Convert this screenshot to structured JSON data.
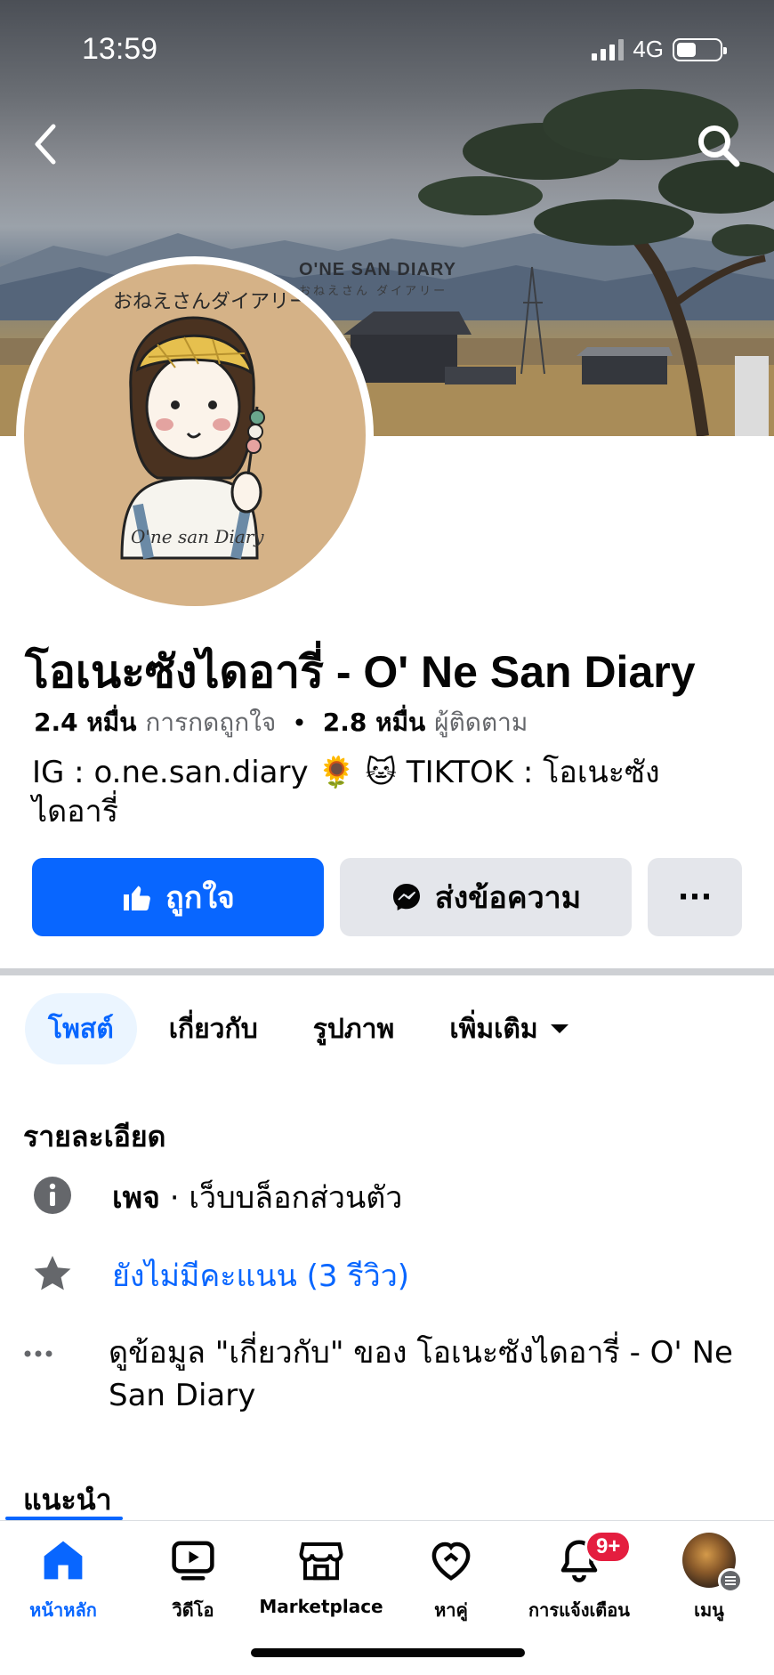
{
  "status_bar": {
    "time": "13:59",
    "network": "4G"
  },
  "cover": {
    "title": "O'NE SAN DIARY",
    "subtitle": "おねえさん ダイアリー"
  },
  "avatar": {
    "jp_text": "おねえさんダイアリー",
    "caption": "O'ne san Diary"
  },
  "profile": {
    "name": "โอเนะซังไดอารี่ - O' Ne San Diary",
    "likes_count": "2.4 หมื่น",
    "likes_label": "การกดถูกใจ",
    "followers_count": "2.8 หมื่น",
    "followers_label": "ผู้ติดตาม",
    "bio_line1": "IG : o.ne.san.diary 🌻 🐱 TIKTOK : โอเนะซัง",
    "bio_line2": "ไดอารี่"
  },
  "actions": {
    "like_label": "ถูกใจ",
    "message_label": "ส่งข้อความ",
    "more_label": "···"
  },
  "tabs": [
    {
      "label": "โพสต์",
      "active": true
    },
    {
      "label": "เกี่ยวกับ"
    },
    {
      "label": "รูปภาพ"
    },
    {
      "label": "เพิ่มเติม"
    }
  ],
  "details": {
    "title": "รายละเอียด",
    "page_type_bold": "เพจ",
    "page_type_rest": " · เว็บบล็อกส่วนตัว",
    "rating": "ยังไม่มีคะแนน (3 รีวิว)",
    "about_line1": "ดูข้อมูล \"เกี่ยวกับ\" ของ โอเนะซังไดอารี่ - O' Ne",
    "about_line2": "San Diary"
  },
  "recommend_title": "แนะนำ",
  "bottom_nav": [
    {
      "label": "หน้าหลัก",
      "icon": "home-icon",
      "active": true
    },
    {
      "label": "วิดีโอ",
      "icon": "video-icon"
    },
    {
      "label": "Marketplace",
      "icon": "marketplace-icon"
    },
    {
      "label": "หาคู่",
      "icon": "dating-icon"
    },
    {
      "label": "การแจ้งเตือน",
      "icon": "bell-icon",
      "badge": "9+"
    },
    {
      "label": "เมนู",
      "icon": "menu-avatar"
    }
  ],
  "colors": {
    "primary": "#0866ff",
    "secondary_button": "#e4e6eb",
    "badge": "#e41e3f",
    "text_secondary": "#65676b"
  }
}
